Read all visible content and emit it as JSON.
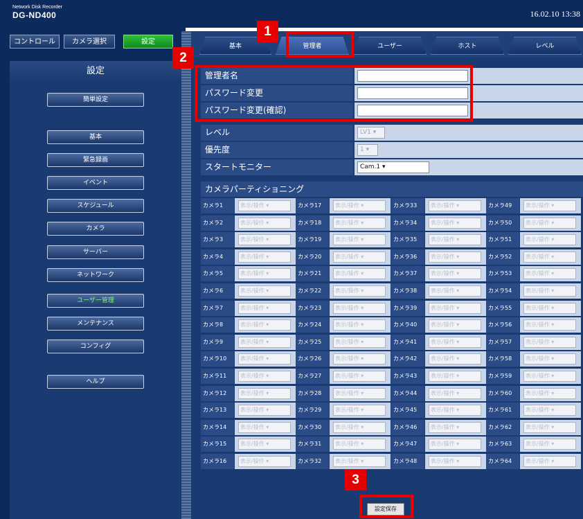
{
  "header": {
    "brand_small": "Network Disk Recorder",
    "model": "DG-ND400",
    "datetime": "16.02.10 13:38"
  },
  "mode_buttons": [
    {
      "label": "コントロール"
    },
    {
      "label": "カメラ選択"
    },
    {
      "label": "設定",
      "active": true
    }
  ],
  "sidebar": {
    "title": "設定",
    "items": [
      {
        "label": "簡単設定"
      },
      {
        "label": "基本"
      },
      {
        "label": "緊急録画"
      },
      {
        "label": "イベント"
      },
      {
        "label": "スケジュール"
      },
      {
        "label": "カメラ"
      },
      {
        "label": "サーバー"
      },
      {
        "label": "ネットワーク"
      },
      {
        "label": "ユーザー管理",
        "active": true
      },
      {
        "label": "メンテナンス"
      },
      {
        "label": "コンフィグ"
      },
      {
        "label": "ヘルプ"
      }
    ]
  },
  "tabs": [
    {
      "label": "基本"
    },
    {
      "label": "管理者",
      "active": true
    },
    {
      "label": "ユーザー"
    },
    {
      "label": "ホスト"
    },
    {
      "label": "レベル"
    }
  ],
  "form": {
    "admin_name_label": "管理者名",
    "admin_name_value": "",
    "password_change_label": "パスワード変更",
    "password_change_value": "",
    "password_confirm_label": "パスワード変更(確認)",
    "password_confirm_value": "",
    "level_label": "レベル",
    "level_value": "LV1",
    "priority_label": "優先度",
    "priority_value": "1",
    "start_monitor_label": "スタートモニター",
    "start_monitor_value": "Cam.1"
  },
  "partition": {
    "title": "カメラパーティショニング",
    "option": "表示/操作",
    "columns": [
      [
        "カメラ1",
        "カメラ2",
        "カメラ3",
        "カメラ4",
        "カメラ5",
        "カメラ6",
        "カメラ7",
        "カメラ8",
        "カメラ9",
        "カメラ10",
        "カメラ11",
        "カメラ12",
        "カメラ13",
        "カメラ14",
        "カメラ15",
        "カメラ16"
      ],
      [
        "カメラ17",
        "カメラ18",
        "カメラ19",
        "カメラ20",
        "カメラ21",
        "カメラ22",
        "カメラ23",
        "カメラ24",
        "カメラ25",
        "カメラ26",
        "カメラ27",
        "カメラ28",
        "カメラ29",
        "カメラ30",
        "カメラ31",
        "カメラ32"
      ],
      [
        "カメラ33",
        "カメラ34",
        "カメラ35",
        "カメラ36",
        "カメラ37",
        "カメラ38",
        "カメラ39",
        "カメラ40",
        "カメラ41",
        "カメラ42",
        "カメラ43",
        "カメラ44",
        "カメラ45",
        "カメラ46",
        "カメラ47",
        "カメラ48"
      ],
      [
        "カメラ49",
        "カメラ50",
        "カメラ51",
        "カメラ52",
        "カメラ53",
        "カメラ54",
        "カメラ55",
        "カメラ56",
        "カメラ57",
        "カメラ58",
        "カメラ59",
        "カメラ60",
        "カメラ61",
        "カメラ62",
        "カメラ63",
        "カメラ64"
      ]
    ]
  },
  "save_button": "設定保存",
  "callouts": [
    "1",
    "2",
    "3"
  ],
  "colors": {
    "highlight": "#e60000",
    "header_bg": "#0d2a5c",
    "label_bg": "#2b4b86",
    "value_bg": "#c9d5e8"
  }
}
